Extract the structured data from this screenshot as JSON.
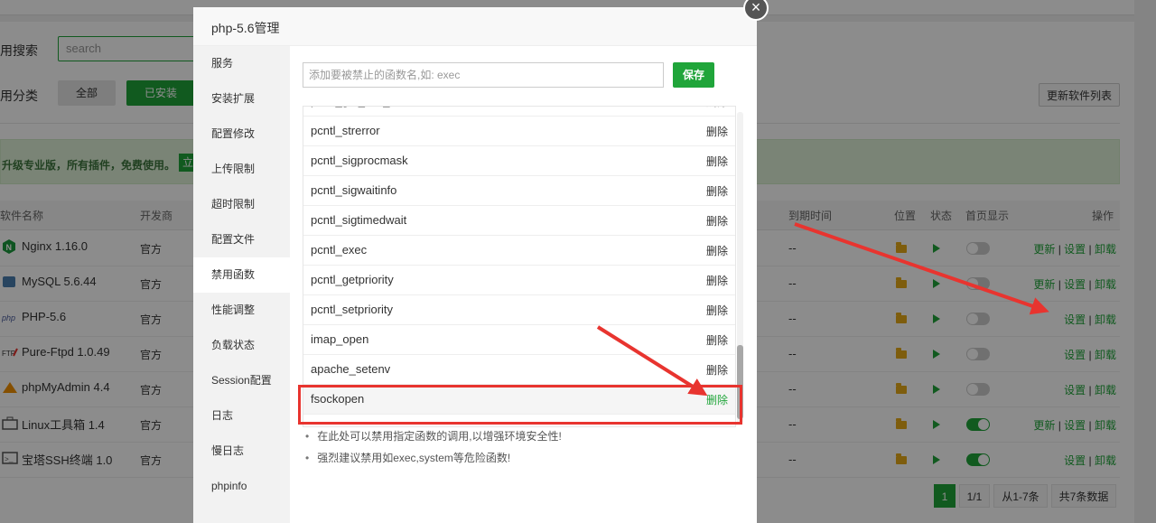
{
  "background": {
    "search_label": "用搜索",
    "search_placeholder": "search",
    "category_label": "用分类",
    "btn_all": "全部",
    "btn_installed": "已安装",
    "btn_update_list": "更新软件列表",
    "promo_text": "升级专业版，所有插件，免费使用。",
    "promo_btn": "立",
    "headers": {
      "name": "软件名称",
      "dev": "开发商",
      "expire": "到期时间",
      "location": "位置",
      "status": "状态",
      "home": "首页显示",
      "ops": "操作"
    },
    "rows": [
      {
        "name": "Nginx 1.16.0",
        "dev": "官方",
        "expire": "--",
        "home_on": false,
        "ops": [
          "更新",
          "设置",
          "卸载"
        ],
        "icon": "nginx-icon"
      },
      {
        "name": "MySQL 5.6.44",
        "dev": "官方",
        "expire": "--",
        "home_on": false,
        "ops": [
          "更新",
          "设置",
          "卸载"
        ],
        "icon": "mysql-icon"
      },
      {
        "name": "PHP-5.6",
        "dev": "官方",
        "expire": "--",
        "home_on": false,
        "ops": [
          "设置",
          "卸载"
        ],
        "icon": "php-icon"
      },
      {
        "name": "Pure-Ftpd 1.0.49",
        "dev": "官方",
        "expire": "--",
        "home_on": false,
        "ops": [
          "设置",
          "卸载"
        ],
        "icon": "ftp-icon"
      },
      {
        "name": "phpMyAdmin 4.4",
        "dev": "官方",
        "expire": "--",
        "home_on": false,
        "ops": [
          "设置",
          "卸载"
        ],
        "icon": "phpmyadmin-icon"
      },
      {
        "name": "Linux工具箱 1.4",
        "dev": "官方",
        "expire": "--",
        "home_on": true,
        "ops": [
          "更新",
          "设置",
          "卸载"
        ],
        "icon": "toolbox-icon"
      },
      {
        "name": "宝塔SSH终端 1.0",
        "dev": "官方",
        "expire": "--",
        "home_on": true,
        "ops": [
          "设置",
          "卸载"
        ],
        "icon": "terminal-icon"
      }
    ],
    "pager": {
      "current": "1",
      "pages": "1/1",
      "range": "从1-7条",
      "total": "共7条数据"
    }
  },
  "modal": {
    "title": "php-5.6管理",
    "nav": [
      "服务",
      "安装扩展",
      "配置修改",
      "上传限制",
      "超时限制",
      "配置文件",
      "禁用函数",
      "性能调整",
      "负载状态",
      "Session配置",
      "日志",
      "慢日志",
      "phpinfo"
    ],
    "active_nav": "禁用函数",
    "input_placeholder": "添加要被禁止的函数名,如: exec",
    "save_label": "保存",
    "delete_label": "删除",
    "functions": [
      "pcntl_get_last_error",
      "pcntl_strerror",
      "pcntl_sigprocmask",
      "pcntl_sigwaitinfo",
      "pcntl_sigtimedwait",
      "pcntl_exec",
      "pcntl_getpriority",
      "pcntl_setpriority",
      "imap_open",
      "apache_setenv",
      "fsockopen"
    ],
    "highlighted_function": "fsockopen",
    "notes": [
      "在此处可以禁用指定函数的调用,以增强环境安全性!",
      "强烈建议禁用如exec,system等危险函数!"
    ]
  },
  "colors": {
    "accent": "#20a53a",
    "annotation": "#e8342f"
  }
}
